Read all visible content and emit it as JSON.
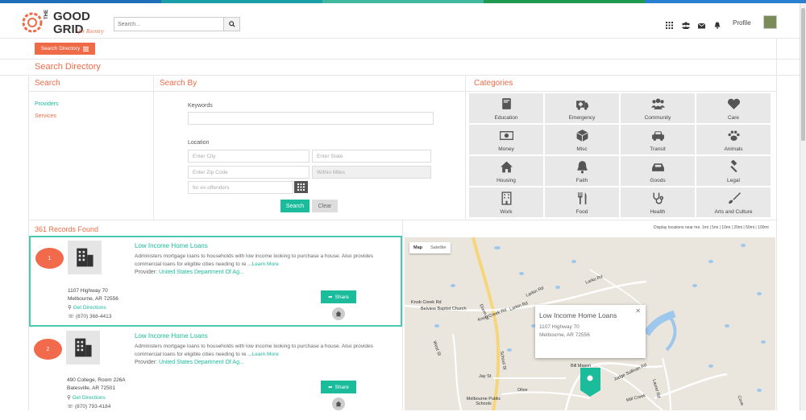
{
  "header": {
    "search_placeholder": "Search...",
    "profile_label": "Profile",
    "stripe_colors": [
      "#1e7bc1",
      "#27b0b9",
      "#48c9b0",
      "#1e9e5a",
      "#2e8ad8"
    ]
  },
  "directory_button": "Search Directory",
  "page_title": "Search Directory",
  "left": {
    "title": "Search",
    "links": [
      "Providers",
      "Services"
    ]
  },
  "search_by": {
    "title": "Search By",
    "keywords_label": "Keywords",
    "keywords_value": "",
    "location_label": "Location",
    "city_placeholder": "Enter City",
    "state_placeholder": "Enter State",
    "zip_placeholder": "Enter Zip Code",
    "within_placeholder": "Within Miles",
    "extra_placeholder": "for ex-offenders",
    "search_button": "Search",
    "clear_button": "Clear"
  },
  "categories": {
    "title": "Categories",
    "items": [
      {
        "label": "Education",
        "icon": "book-icon"
      },
      {
        "label": "Emergency",
        "icon": "ambulance-icon"
      },
      {
        "label": "Community",
        "icon": "users-icon"
      },
      {
        "label": "Care",
        "icon": "heart-icon"
      },
      {
        "label": "Money",
        "icon": "money-icon"
      },
      {
        "label": "Misc",
        "icon": "cube-icon"
      },
      {
        "label": "Transit",
        "icon": "car-icon"
      },
      {
        "label": "Animals",
        "icon": "paw-icon"
      },
      {
        "label": "Housing",
        "icon": "home-icon"
      },
      {
        "label": "Faith",
        "icon": "bell-icon"
      },
      {
        "label": "Goods",
        "icon": "tray-icon"
      },
      {
        "label": "Legal",
        "icon": "gavel-icon"
      },
      {
        "label": "Work",
        "icon": "building-icon"
      },
      {
        "label": "Food",
        "icon": "cutlery-icon"
      },
      {
        "label": "Health",
        "icon": "stethoscope-icon"
      },
      {
        "label": "Arts and Culture",
        "icon": "brush-icon"
      }
    ]
  },
  "results": {
    "count_label": "361 Records Found",
    "radius_label": "Display locations near me: 1mi | 5mi | 10mi | 20mi | 50mi | 100mi",
    "cards": [
      {
        "num": "1",
        "title": "Low Income Home Loans",
        "desc": "Administers mortgage loans to households with low income looking to purchase a house. Also provides commercial loans for eligible cities needing to re ...",
        "more": "Learn More",
        "provider_label": "Provider:",
        "provider": "United States Department Of Ag...",
        "address1": "1107 Highway 70",
        "address2": "Melbourne, AR 72556",
        "directions": "Get Directions",
        "phone": "(870) 368-4413",
        "share": "Share"
      },
      {
        "num": "2",
        "title": "Low Income Home Loans",
        "desc": "Administers mortgage loans to households with low income looking to purchase a house. Also provides commercial loans for eligible cities needing to re ...",
        "more": "Learn More",
        "provider_label": "Provider:",
        "provider": "United States Department Of Ag...",
        "address1": "490 College, Room 226A",
        "address2": "Batesville, AR 72501",
        "directions": "Get Directions",
        "phone": "(870) 793-4184",
        "share": "Share"
      }
    ]
  },
  "map": {
    "type_map": "Map",
    "type_satellite": "Satellite",
    "info_title": "Low Income Home Loans",
    "info_addr1": "1107 Highway 70",
    "info_addr2": "Melbourne, AR 72556",
    "labels": [
      "Knob Creek Rd",
      "Belview Baptist Church",
      "Larkin Rd",
      "Knob Creek Rd",
      "Larko Rd",
      "Larkin Rd",
      "Dixon St",
      "West St",
      "School St",
      "Jay St",
      "Olive",
      "Bill Mason",
      "Judge Sullivan Rd",
      "Melbourne Public Schools",
      "Mill Creek",
      "Laurel Rd",
      "Cove"
    ]
  }
}
